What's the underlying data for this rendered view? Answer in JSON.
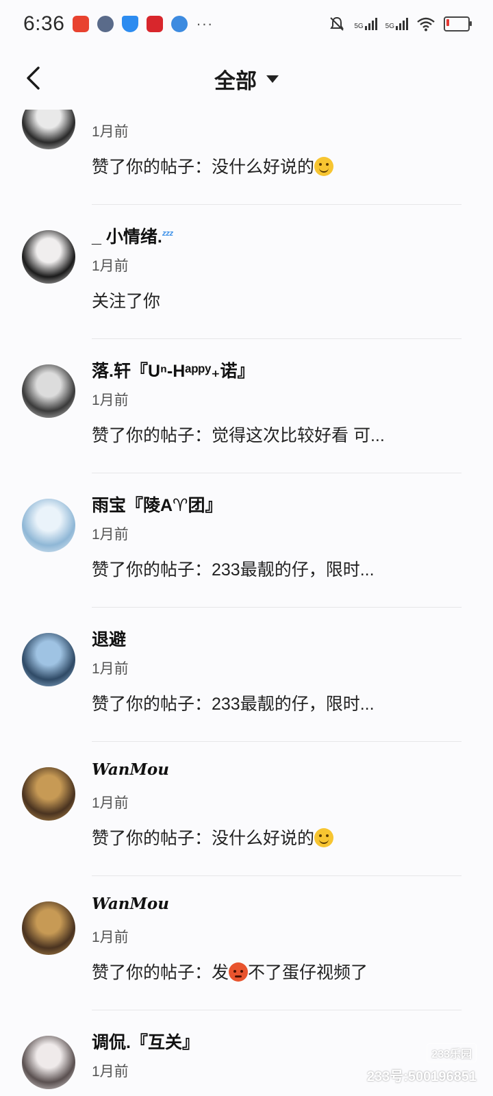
{
  "status_bar": {
    "time": "6:36",
    "signal_1": "5G",
    "signal_2": "5G",
    "dots": "···"
  },
  "header": {
    "title": "全部"
  },
  "items": [
    {
      "username": "",
      "time": "1月前",
      "message_prefix": "赞了你的帖子：没什么好说的",
      "emoji": "smile",
      "message_suffix": "",
      "avatar_colors": [
        "#2a2a2a",
        "#e9e9e9"
      ]
    },
    {
      "username": "_ 小情绪.",
      "username_suffix": "ᶻᶻᶻ",
      "time": "1月前",
      "message_prefix": "关注了你",
      "emoji": "",
      "message_suffix": "",
      "avatar_colors": [
        "#1b1b1b",
        "#f0eeee"
      ]
    },
    {
      "username": "落.轩『Uⁿ-Hᵃᵖᵖʸ₊诺』",
      "time": "1月前",
      "message_prefix": "赞了你的帖子：觉得这次比较好看 可...",
      "emoji": "",
      "message_suffix": "",
      "avatar_colors": [
        "#3a3a3a",
        "#dcdcdc"
      ]
    },
    {
      "username": "雨宝『陵A♈团』",
      "time": "1月前",
      "message_prefix": "赞了你的帖子：233最靓的仔，限时...",
      "emoji": "",
      "message_suffix": "",
      "avatar_colors": [
        "#8fb7d6",
        "#eaf3fa"
      ]
    },
    {
      "username": "退避",
      "time": "1月前",
      "message_prefix": "赞了你的帖子：233最靓的仔，限时...",
      "emoji": "",
      "message_suffix": "",
      "avatar_colors": [
        "#2f4a66",
        "#9fc3e3"
      ]
    },
    {
      "username": "WanMou",
      "script": true,
      "time": "1月前",
      "message_prefix": "赞了你的帖子：没什么好说的",
      "emoji": "smile",
      "message_suffix": "",
      "avatar_colors": [
        "#4a3320",
        "#c79a55"
      ]
    },
    {
      "username": "WanMou",
      "script": true,
      "time": "1月前",
      "message_prefix": "赞了你的帖子：发",
      "emoji": "angry",
      "message_suffix": "不了蛋仔视频了",
      "avatar_colors": [
        "#4a3320",
        "#c79a55"
      ]
    },
    {
      "username": "调侃.『互关』",
      "time": "1月前",
      "message_prefix": "",
      "emoji": "",
      "message_suffix": "",
      "avatar_colors": [
        "#5a5050",
        "#efeaea"
      ]
    }
  ],
  "watermark": {
    "logo": "233乐园",
    "id": "233号:500196851"
  }
}
